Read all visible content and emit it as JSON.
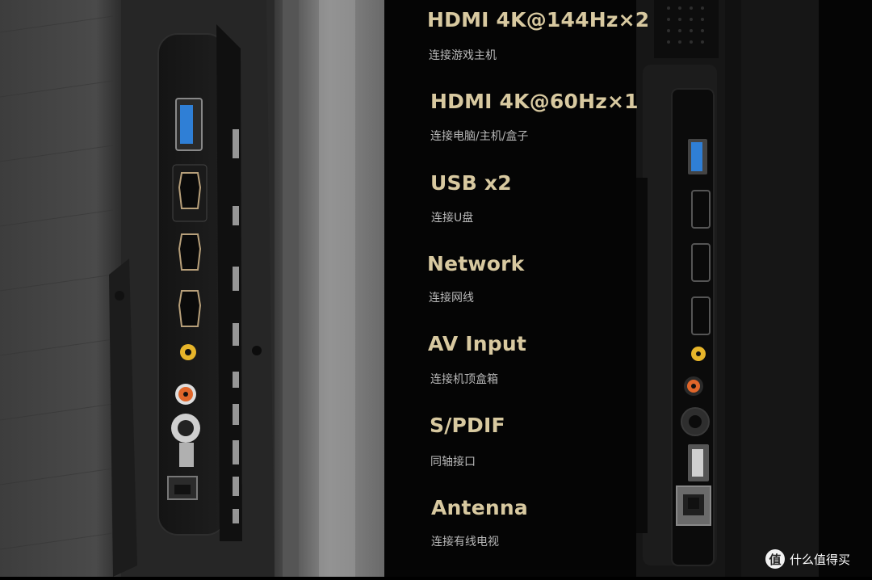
{
  "specs": [
    {
      "title": "HDMI 4K@144Hz×2",
      "subtitle": "连接游戏主机"
    },
    {
      "title": "HDMI 4K@60Hz×1",
      "subtitle": "连接电脑/主机/盒子"
    },
    {
      "title": "USB x2",
      "subtitle": "连接U盘"
    },
    {
      "title": "Network",
      "subtitle": "连接网线"
    },
    {
      "title": "AV Input",
      "subtitle": "连接机顶盒箱"
    },
    {
      "title": "S/PDIF",
      "subtitle": "同轴接口"
    },
    {
      "title": "Antenna",
      "subtitle": "连接有线电视"
    }
  ],
  "watermark": {
    "logo": "值",
    "text": "什么值得买"
  },
  "colors": {
    "title_gold": "#d8c9a0",
    "subtitle_gray": "#b9b9b9",
    "panel_black": "#0b0b0b",
    "usb_blue": "#2f7fd6",
    "av_yellow": "#e7b52a",
    "av_orange": "#e0662a"
  }
}
